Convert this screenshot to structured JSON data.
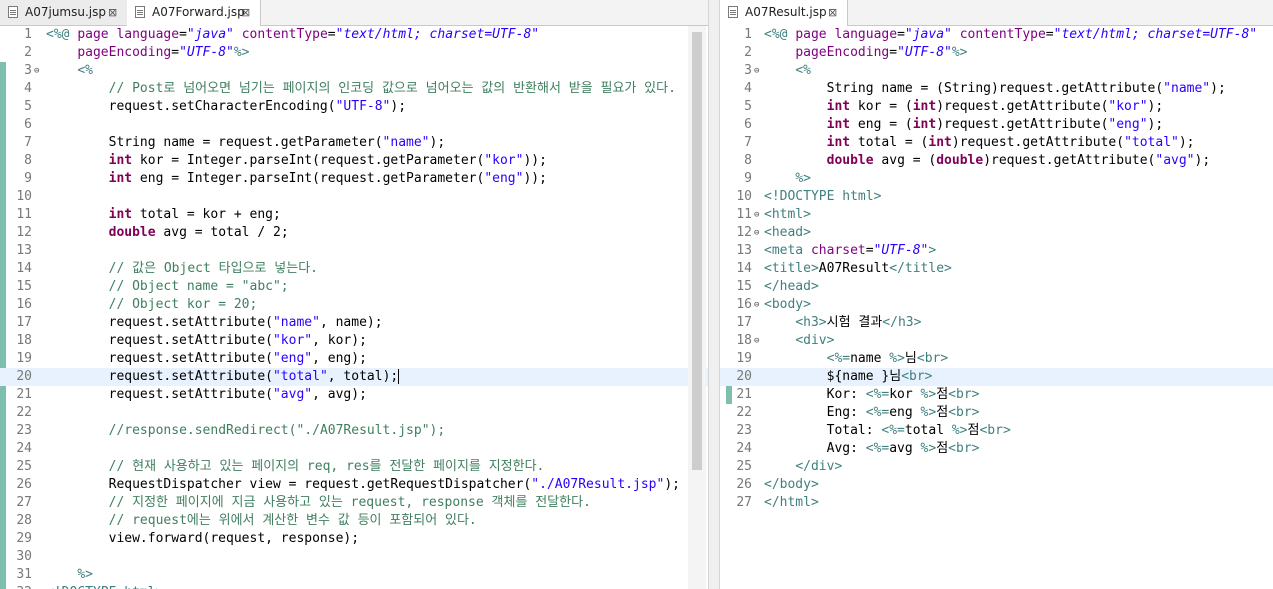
{
  "left": {
    "tabs": [
      {
        "label": "A07jumsu.jsp",
        "close": "⊠"
      },
      {
        "label": "A07Forward.jsp",
        "close": "⊠"
      }
    ],
    "lines": [
      {
        "n": "1",
        "s": [
          [
            "ac",
            "<%@ "
          ],
          [
            "ab",
            "page "
          ],
          [
            "ab",
            "language"
          ],
          [
            "",
            "="
          ],
          [
            "av",
            "\"java\""
          ],
          [
            "",
            " "
          ],
          [
            "ab",
            "contentType"
          ],
          [
            "",
            "="
          ],
          [
            "av",
            "\"text/html; charset=UTF-8\""
          ]
        ]
      },
      {
        "n": "2",
        "s": [
          [
            "",
            "    "
          ],
          [
            "ab",
            "pageEncoding"
          ],
          [
            "",
            "="
          ],
          [
            "av",
            "\"UTF-8\""
          ],
          [
            "ac",
            "%>"
          ]
        ]
      },
      {
        "n": "3",
        "fold": "⊖",
        "s": [
          [
            "",
            "    "
          ],
          [
            "ac",
            "<%"
          ]
        ]
      },
      {
        "n": "4",
        "s": [
          [
            "",
            "        "
          ],
          [
            "c",
            "// Post로 넘어오면 넘기는 페이지의 인코딩 값으로 넘어오는 값의 반환해서 받을 필요가 있다."
          ]
        ]
      },
      {
        "n": "5",
        "s": [
          [
            "",
            "        request.setCharacterEncoding("
          ],
          [
            "s",
            "\"UTF-8\""
          ],
          [
            "",
            ");"
          ]
        ]
      },
      {
        "n": "6",
        "s": [
          [
            "",
            ""
          ]
        ]
      },
      {
        "n": "7",
        "s": [
          [
            "",
            "        String name = request.getParameter("
          ],
          [
            "s",
            "\"name\""
          ],
          [
            "",
            ");"
          ]
        ]
      },
      {
        "n": "8",
        "s": [
          [
            "",
            "        "
          ],
          [
            "k",
            "int"
          ],
          [
            "",
            " kor = Integer.parseInt(request.getParameter("
          ],
          [
            "s",
            "\"kor\""
          ],
          [
            "",
            "));"
          ]
        ]
      },
      {
        "n": "9",
        "s": [
          [
            "",
            "        "
          ],
          [
            "k",
            "int"
          ],
          [
            "",
            " eng = Integer.parseInt(request.getParameter("
          ],
          [
            "s",
            "\"eng\""
          ],
          [
            "",
            "));"
          ]
        ]
      },
      {
        "n": "10",
        "s": [
          [
            "",
            ""
          ]
        ]
      },
      {
        "n": "11",
        "s": [
          [
            "",
            "        "
          ],
          [
            "k",
            "int"
          ],
          [
            "",
            " total = kor + eng;"
          ]
        ]
      },
      {
        "n": "12",
        "s": [
          [
            "",
            "        "
          ],
          [
            "k",
            "double"
          ],
          [
            "",
            " avg = total / 2;"
          ]
        ]
      },
      {
        "n": "13",
        "s": [
          [
            "",
            ""
          ]
        ]
      },
      {
        "n": "14",
        "s": [
          [
            "",
            "        "
          ],
          [
            "c",
            "// 값은 Object 타입으로 넣는다."
          ]
        ]
      },
      {
        "n": "15",
        "s": [
          [
            "",
            "        "
          ],
          [
            "c",
            "// Object name = \"abc\";"
          ]
        ]
      },
      {
        "n": "16",
        "s": [
          [
            "",
            "        "
          ],
          [
            "c",
            "// Object kor = 20;"
          ]
        ]
      },
      {
        "n": "17",
        "s": [
          [
            "",
            "        request.setAttribute("
          ],
          [
            "s",
            "\"name\""
          ],
          [
            "",
            ", name);"
          ]
        ]
      },
      {
        "n": "18",
        "s": [
          [
            "",
            "        request.setAttribute("
          ],
          [
            "s",
            "\"kor\""
          ],
          [
            "",
            ", kor);"
          ]
        ]
      },
      {
        "n": "19",
        "s": [
          [
            "",
            "        request.setAttribute("
          ],
          [
            "s",
            "\"eng\""
          ],
          [
            "",
            ", eng);"
          ]
        ]
      },
      {
        "n": "20",
        "current": true,
        "s": [
          [
            "",
            "        request.setAttribute("
          ],
          [
            "s",
            "\"total\""
          ],
          [
            "",
            ", total);"
          ]
        ]
      },
      {
        "n": "21",
        "s": [
          [
            "",
            "        request.setAttribute("
          ],
          [
            "s",
            "\"avg\""
          ],
          [
            "",
            ", avg);"
          ]
        ]
      },
      {
        "n": "22",
        "s": [
          [
            "",
            ""
          ]
        ]
      },
      {
        "n": "23",
        "s": [
          [
            "",
            "        "
          ],
          [
            "c",
            "//response.sendRedirect(\"./A07Result.jsp\");"
          ]
        ]
      },
      {
        "n": "24",
        "s": [
          [
            "",
            ""
          ]
        ]
      },
      {
        "n": "25",
        "s": [
          [
            "",
            "        "
          ],
          [
            "c",
            "// 현재 사용하고 있는 페이지의 req, res를 전달한 페이지를 지정한다."
          ]
        ]
      },
      {
        "n": "26",
        "s": [
          [
            "",
            "        RequestDispatcher view = request.getRequestDispatcher("
          ],
          [
            "s",
            "\"./A07Result.jsp\""
          ],
          [
            "",
            ");"
          ]
        ]
      },
      {
        "n": "27",
        "s": [
          [
            "",
            "        "
          ],
          [
            "c",
            "// 지정한 페이지에 지금 사용하고 있는 request, response 객체를 전달한다."
          ]
        ]
      },
      {
        "n": "28",
        "s": [
          [
            "",
            "        "
          ],
          [
            "c",
            "// request에는 위에서 계산한 변수 값 등이 포함되어 있다."
          ]
        ]
      },
      {
        "n": "29",
        "s": [
          [
            "",
            "        view.forward(request, response);"
          ]
        ]
      },
      {
        "n": "30",
        "s": [
          [
            "",
            ""
          ]
        ]
      },
      {
        "n": "31",
        "s": [
          [
            "",
            "    "
          ],
          [
            "ac",
            "%>"
          ]
        ]
      },
      {
        "n": "32",
        "s": [
          [
            "tag",
            "<!DOCTYPE html>"
          ]
        ]
      }
    ]
  },
  "right": {
    "tabs": [
      {
        "label": "A07Result.jsp",
        "close": "⊠"
      }
    ],
    "lines": [
      {
        "n": "1",
        "s": [
          [
            "ac",
            "<%@ "
          ],
          [
            "ab",
            "page "
          ],
          [
            "ab",
            "language"
          ],
          [
            "",
            "="
          ],
          [
            "av",
            "\"java\""
          ],
          [
            "",
            " "
          ],
          [
            "ab",
            "contentType"
          ],
          [
            "",
            "="
          ],
          [
            "av",
            "\"text/html; charset=UTF-8\""
          ]
        ]
      },
      {
        "n": "2",
        "s": [
          [
            "",
            "    "
          ],
          [
            "ab",
            "pageEncoding"
          ],
          [
            "",
            "="
          ],
          [
            "av",
            "\"UTF-8\""
          ],
          [
            "ac",
            "%>"
          ]
        ]
      },
      {
        "n": "3",
        "fold": "⊖",
        "s": [
          [
            "",
            "    "
          ],
          [
            "ac",
            "<%"
          ]
        ]
      },
      {
        "n": "4",
        "s": [
          [
            "",
            "        String name = (String)request.getAttribute("
          ],
          [
            "s",
            "\"name\""
          ],
          [
            "",
            ");"
          ]
        ]
      },
      {
        "n": "5",
        "s": [
          [
            "",
            "        "
          ],
          [
            "k",
            "int"
          ],
          [
            "",
            " kor = ("
          ],
          [
            "k",
            "int"
          ],
          [
            "",
            ")request.getAttribute("
          ],
          [
            "s",
            "\"kor\""
          ],
          [
            "",
            ");"
          ]
        ]
      },
      {
        "n": "6",
        "s": [
          [
            "",
            "        "
          ],
          [
            "k",
            "int"
          ],
          [
            "",
            " eng = ("
          ],
          [
            "k",
            "int"
          ],
          [
            "",
            ")request.getAttribute("
          ],
          [
            "s",
            "\"eng\""
          ],
          [
            "",
            ");"
          ]
        ]
      },
      {
        "n": "7",
        "s": [
          [
            "",
            "        "
          ],
          [
            "k",
            "int"
          ],
          [
            "",
            " total = ("
          ],
          [
            "k",
            "int"
          ],
          [
            "",
            ")request.getAttribute("
          ],
          [
            "s",
            "\"total\""
          ],
          [
            "",
            ");"
          ]
        ]
      },
      {
        "n": "8",
        "s": [
          [
            "",
            "        "
          ],
          [
            "k",
            "double"
          ],
          [
            "",
            " avg = ("
          ],
          [
            "k",
            "double"
          ],
          [
            "",
            ")request.getAttribute("
          ],
          [
            "s",
            "\"avg\""
          ],
          [
            "",
            ");"
          ]
        ]
      },
      {
        "n": "9",
        "s": [
          [
            "",
            "    "
          ],
          [
            "ac",
            "%>"
          ]
        ]
      },
      {
        "n": "10",
        "s": [
          [
            "tag",
            "<!DOCTYPE html>"
          ]
        ]
      },
      {
        "n": "11",
        "fold": "⊖",
        "s": [
          [
            "tag",
            "<html>"
          ]
        ]
      },
      {
        "n": "12",
        "fold": "⊖",
        "s": [
          [
            "tag",
            "<head>"
          ]
        ]
      },
      {
        "n": "13",
        "s": [
          [
            "tag",
            "<meta "
          ],
          [
            "ab",
            "charset"
          ],
          [
            "",
            "="
          ],
          [
            "av",
            "\"UTF-8\""
          ],
          [
            "tag",
            ">"
          ]
        ]
      },
      {
        "n": "14",
        "s": [
          [
            "tag",
            "<title>"
          ],
          [
            "",
            "A07Result"
          ],
          [
            "tag",
            "</title>"
          ]
        ]
      },
      {
        "n": "15",
        "s": [
          [
            "tag",
            "</head>"
          ]
        ]
      },
      {
        "n": "16",
        "fold": "⊖",
        "s": [
          [
            "tag",
            "<body>"
          ]
        ]
      },
      {
        "n": "17",
        "s": [
          [
            "",
            "    "
          ],
          [
            "tag",
            "<h3>"
          ],
          [
            "",
            "시험 결과"
          ],
          [
            "tag",
            "</h3>"
          ]
        ]
      },
      {
        "n": "18",
        "fold": "⊖",
        "s": [
          [
            "",
            "    "
          ],
          [
            "tag",
            "<div>"
          ]
        ]
      },
      {
        "n": "19",
        "s": [
          [
            "",
            "        "
          ],
          [
            "ac",
            "<%="
          ],
          [
            "",
            "name "
          ],
          [
            "ac",
            "%>"
          ],
          [
            "",
            "님"
          ],
          [
            "tag",
            "<br>"
          ]
        ]
      },
      {
        "n": "20",
        "current": true,
        "s": [
          [
            "",
            "        ${name }님"
          ],
          [
            "tag",
            "<br>"
          ]
        ]
      },
      {
        "n": "21",
        "s": [
          [
            "",
            "        Kor: "
          ],
          [
            "ac",
            "<%="
          ],
          [
            "",
            "kor "
          ],
          [
            "ac",
            "%>"
          ],
          [
            "",
            "점"
          ],
          [
            "tag",
            "<br>"
          ]
        ]
      },
      {
        "n": "22",
        "s": [
          [
            "",
            "        Eng: "
          ],
          [
            "ac",
            "<%="
          ],
          [
            "",
            "eng "
          ],
          [
            "ac",
            "%>"
          ],
          [
            "",
            "점"
          ],
          [
            "tag",
            "<br>"
          ]
        ]
      },
      {
        "n": "23",
        "s": [
          [
            "",
            "        Total: "
          ],
          [
            "ac",
            "<%="
          ],
          [
            "",
            "total "
          ],
          [
            "ac",
            "%>"
          ],
          [
            "",
            "점"
          ],
          [
            "tag",
            "<br>"
          ]
        ]
      },
      {
        "n": "24",
        "s": [
          [
            "",
            "        Avg: "
          ],
          [
            "ac",
            "<%="
          ],
          [
            "",
            "avg "
          ],
          [
            "ac",
            "%>"
          ],
          [
            "",
            "점"
          ],
          [
            "tag",
            "<br>"
          ]
        ]
      },
      {
        "n": "25",
        "s": [
          [
            "",
            "    "
          ],
          [
            "tag",
            "</div>"
          ]
        ]
      },
      {
        "n": "26",
        "s": [
          [
            "tag",
            "</body>"
          ]
        ]
      },
      {
        "n": "27",
        "s": [
          [
            "tag",
            "</html>"
          ]
        ]
      }
    ]
  }
}
